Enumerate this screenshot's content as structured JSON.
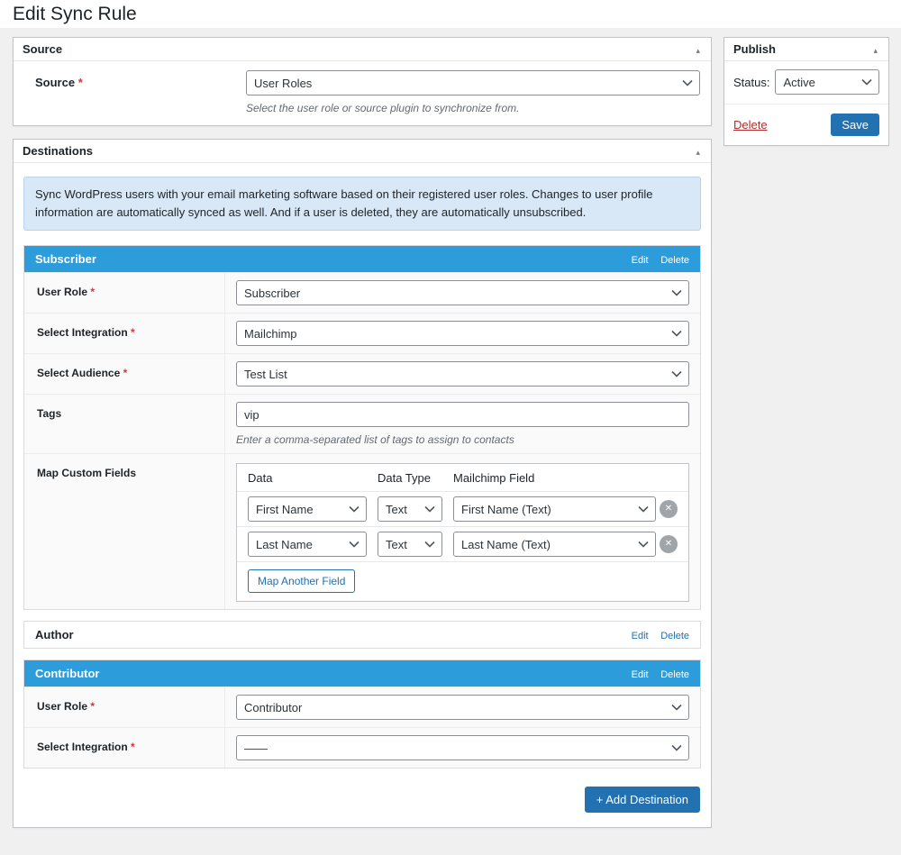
{
  "page": {
    "title": "Edit Sync Rule"
  },
  "icons": {
    "collapse_arrow": "▴",
    "close": "✕"
  },
  "colors": {
    "header_blue": "#2d9cdb",
    "button_blue": "#2271b1",
    "delete_red": "#b32d2e",
    "notice_bg": "#d9e8f6"
  },
  "source": {
    "panel_title": "Source",
    "label": "Source",
    "required": "*",
    "value": "User Roles",
    "description": "Select the user role or source plugin to synchronize from."
  },
  "publish": {
    "panel_title": "Publish",
    "status_label": "Status:",
    "status_value": "Active",
    "delete": "Delete",
    "save": "Save"
  },
  "destinations": {
    "panel_title": "Destinations",
    "notice": "Sync WordPress users with your email marketing software based on their registered user roles. Changes to user profile information are automatically synced as well. And if a user is deleted, they are automatically unsubscribed.",
    "add_button": "+ Add Destination",
    "subscriber": {
      "title": "Subscriber",
      "edit": "Edit",
      "delete": "Delete",
      "user_role": {
        "label": "User Role",
        "required": "*",
        "value": "Subscriber"
      },
      "integration": {
        "label": "Select Integration",
        "required": "*",
        "value": "Mailchimp"
      },
      "audience": {
        "label": "Select Audience",
        "required": "*",
        "value": "Test List"
      },
      "tags": {
        "label": "Tags",
        "value": "vip",
        "description": "Enter a comma-separated list of tags to assign to contacts"
      },
      "map_fields": {
        "label": "Map Custom Fields",
        "col_data": "Data",
        "col_type": "Data Type",
        "col_field": "Mailchimp Field",
        "rows": [
          {
            "data": "First Name",
            "type": "Text",
            "field": "First Name (Text)"
          },
          {
            "data": "Last Name",
            "type": "Text",
            "field": "Last Name (Text)"
          }
        ],
        "add_button": "Map Another Field"
      }
    },
    "author": {
      "title": "Author",
      "edit": "Edit",
      "delete": "Delete"
    },
    "contributor": {
      "title": "Contributor",
      "edit": "Edit",
      "delete": "Delete",
      "user_role": {
        "label": "User Role",
        "required": "*",
        "value": "Contributor"
      },
      "integration": {
        "label": "Select Integration",
        "required": "*",
        "value": "——"
      }
    }
  }
}
